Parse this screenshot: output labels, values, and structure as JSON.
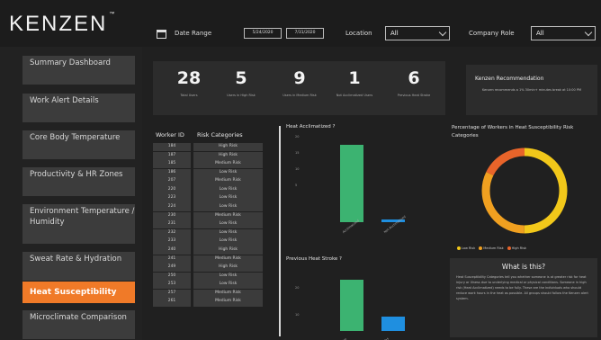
{
  "brand": {
    "logo_text": "KENZEN",
    "trademark": "™"
  },
  "filters": {
    "date_range_label": "Date Range",
    "date_start": "5/24/2020",
    "date_end": "7/31/2020",
    "location_label": "Location",
    "location_value": "All",
    "company_role_label": "Company Role",
    "company_role_value": "All"
  },
  "sidebar": {
    "items": [
      {
        "label": "Summary Dashboard"
      },
      {
        "label": "Work Alert Details"
      },
      {
        "label": "Core Body Temperature"
      },
      {
        "label": "Productivity & HR Zones"
      },
      {
        "label": "Environment Temperature / Humidity"
      },
      {
        "label": "Sweat Rate & Hydration"
      },
      {
        "label": "Heat Susceptibility",
        "active": true
      },
      {
        "label": "Microclimate Comparison"
      }
    ]
  },
  "kpis": [
    {
      "value": "28",
      "label": "Total Users"
    },
    {
      "value": "5",
      "label": "Users in High Risk"
    },
    {
      "value": "9",
      "label": "Users in Medium Risk"
    },
    {
      "value": "1",
      "label": "Not Acclimatized Users"
    },
    {
      "value": "6",
      "label": "Previous Heat Stroke"
    }
  ],
  "recommendation": {
    "title": "Kenzen Recommendation",
    "text": "Kenzen recommends a 1% 30min+ minutes break at 10:00 PM"
  },
  "worker_table": {
    "headers": {
      "worker_id": "Worker ID",
      "risk": "Risk Categories"
    },
    "rows": [
      {
        "id": "184",
        "risk": "High Risk"
      },
      {
        "id": "187",
        "risk": "High Risk"
      },
      {
        "id": "185",
        "risk": "Medium Risk"
      },
      {
        "id": "186",
        "risk": "Low Risk"
      },
      {
        "id": "207",
        "risk": "Medium Risk"
      },
      {
        "id": "220",
        "risk": "Low Risk"
      },
      {
        "id": "223",
        "risk": "Low Risk"
      },
      {
        "id": "224",
        "risk": "Low Risk"
      },
      {
        "id": "230",
        "risk": "Medium Risk"
      },
      {
        "id": "231",
        "risk": "Low Risk"
      },
      {
        "id": "232",
        "risk": "Low Risk"
      },
      {
        "id": "233",
        "risk": "Low Risk"
      },
      {
        "id": "240",
        "risk": "High Risk"
      },
      {
        "id": "241",
        "risk": "Medium Risk"
      },
      {
        "id": "249",
        "risk": "High Risk"
      },
      {
        "id": "250",
        "risk": "Low Risk"
      },
      {
        "id": "253",
        "risk": "Low Risk"
      },
      {
        "id": "257",
        "risk": "Medium Risk"
      },
      {
        "id": "261",
        "risk": "Medium Risk"
      }
    ]
  },
  "chart_data": [
    {
      "type": "bar",
      "title": "Heat Acclimatized ?",
      "categories": [
        "Acclimatized",
        "Not Acclimatized"
      ],
      "values": [
        27,
        1
      ],
      "ylim": [
        0,
        30
      ],
      "yticks": [
        "20",
        "15",
        "10",
        "5"
      ],
      "colors": [
        "#3cb371",
        "#1f8fe0"
      ]
    },
    {
      "type": "bar",
      "title": "Previous Heat Stroke ?",
      "categories": [
        "No",
        "Yes"
      ],
      "values": [
        22,
        6
      ],
      "ylim": [
        0,
        25
      ],
      "yticks": [
        "20",
        "10"
      ],
      "colors": [
        "#3cb371",
        "#1f8fe0"
      ]
    },
    {
      "type": "pie",
      "title": "Percentage of Workers in Heat Susceptibility Risk Categories",
      "categories": [
        "Low Risk",
        "Medium Risk",
        "High Risk"
      ],
      "values": [
        14,
        9,
        5
      ],
      "colors": [
        "#f2c81a",
        "#f0a020",
        "#e8642a"
      ]
    }
  ],
  "info": {
    "title": "What is this?",
    "text": "Heat Susceptibility Categories tell you whether someone is at greater risk for heat injury or illness due to underlying medical or physical conditions. Someone in high risk (Heat Acclimatized) needs to be fully. These are the individuals who should reduce work hours in the heat as possible. All groups should follow the Kenzen alert system."
  }
}
